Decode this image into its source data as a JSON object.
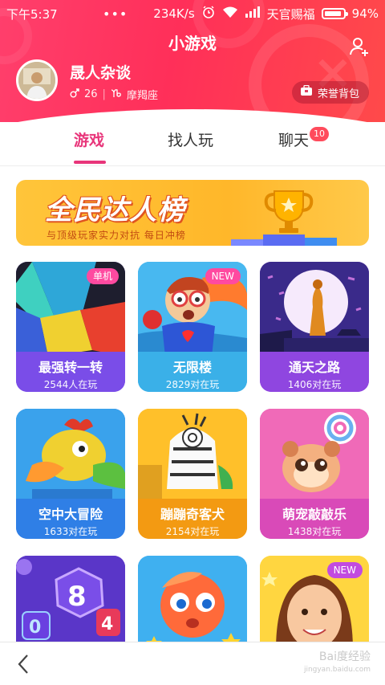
{
  "status_bar": {
    "time": "下午5:37",
    "dots": "•••",
    "speed": "234K/s",
    "carrier": "天官赐福",
    "battery": "94%",
    "battery_level": 0.94
  },
  "header": {
    "title": "小游戏",
    "username": "晟人杂谈",
    "age": "26",
    "zodiac": "摩羯座",
    "honor_button": "荣誉背包"
  },
  "tabs": [
    {
      "label": "游戏",
      "active": true
    },
    {
      "label": "找人玩",
      "active": false
    },
    {
      "label": "聊天",
      "active": false,
      "badge": "10"
    }
  ],
  "banner": {
    "title": "全民达人榜",
    "subtitle": "与顶级玩家实力对抗 每日冲榜"
  },
  "games": [
    {
      "name": "最强转一转",
      "count": "2544人在玩",
      "tag": "单机",
      "color": "#7a4de8"
    },
    {
      "name": "无限楼",
      "count": "2829对在玩",
      "tag": "NEW",
      "color": "#3ab0e8"
    },
    {
      "name": "通天之路",
      "count": "1406对在玩",
      "tag": "",
      "color": "#8f46e0"
    },
    {
      "name": "空中大冒险",
      "count": "1633对在玩",
      "tag": "",
      "color": "#2f7fe6"
    },
    {
      "name": "蹦蹦奇客犬",
      "count": "2154对在玩",
      "tag": "",
      "color": "#f39a12"
    },
    {
      "name": "萌宠敲敲乐",
      "count": "1438对在玩",
      "tag": "",
      "color": "#d94ab8"
    },
    {
      "name": "",
      "count": "",
      "tag": "",
      "color": "#6b3ed6"
    },
    {
      "name": "",
      "count": "",
      "tag": "",
      "color": "#3fa9f0"
    },
    {
      "name": "",
      "count": "",
      "tag": "NEW",
      "color": "#ffd640"
    }
  ],
  "bottom": {
    "watermark": "Bai度经验",
    "watermark_sub": "jingyan.baidu.com"
  }
}
